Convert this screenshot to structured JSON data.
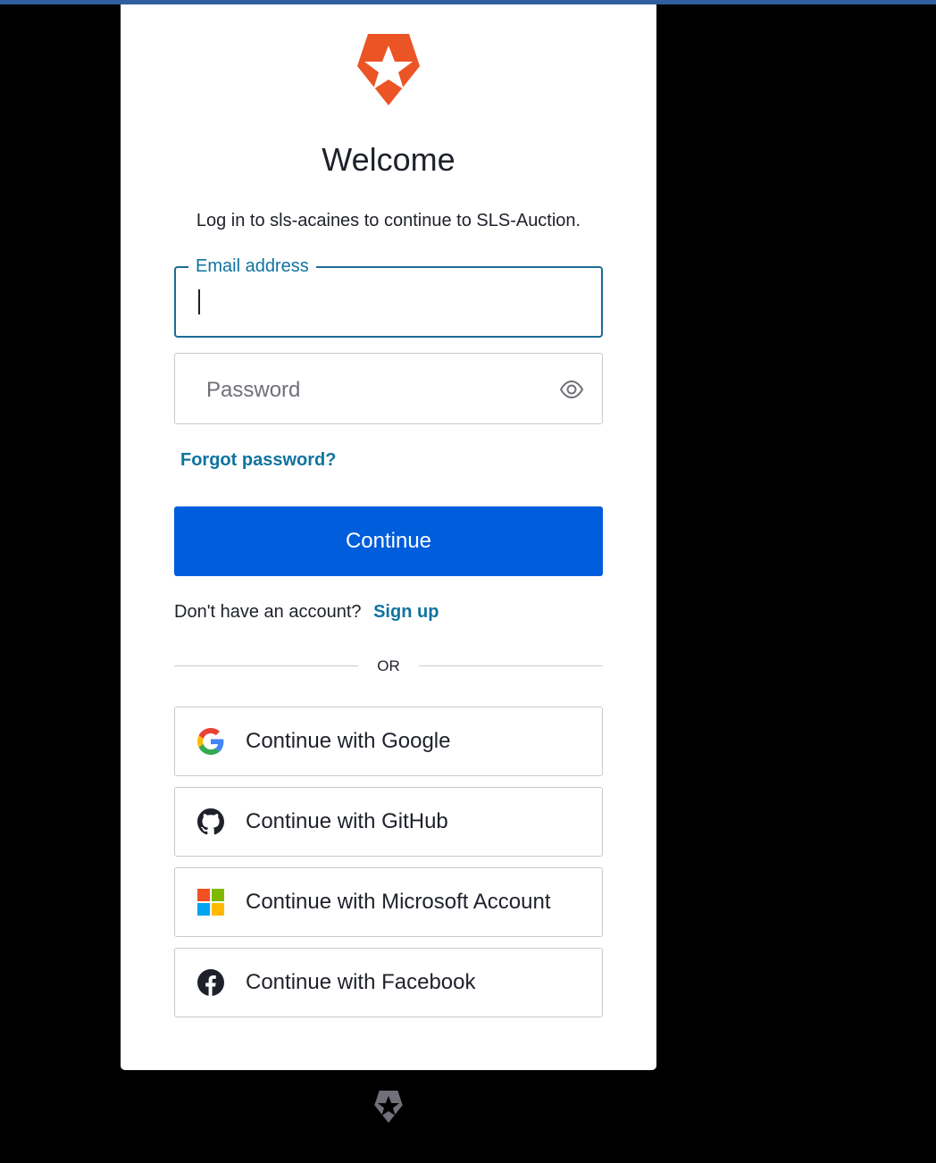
{
  "brand": {
    "logo_icon": "auth0-shield-star-icon",
    "accent_color": "#eb5424",
    "primary_color": "#005ddb",
    "link_color": "#0f73a0"
  },
  "header": {
    "title": "Welcome",
    "subtitle": "Log in to sls-acaines to continue to SLS-Auction."
  },
  "form": {
    "email": {
      "label": "Email address",
      "value": ""
    },
    "password": {
      "placeholder": "Password",
      "toggle_icon": "eye-icon"
    },
    "forgot_label": "Forgot password?",
    "continue_label": "Continue"
  },
  "signup": {
    "prompt": "Don't have an account?",
    "link_label": "Sign up"
  },
  "divider": {
    "label": "OR"
  },
  "social": [
    {
      "label": "Continue with Google",
      "icon": "google-icon"
    },
    {
      "label": "Continue with GitHub",
      "icon": "github-icon"
    },
    {
      "label": "Continue with Microsoft Account",
      "icon": "microsoft-icon"
    },
    {
      "label": "Continue with Facebook",
      "icon": "facebook-icon"
    }
  ],
  "footer": {
    "logo_icon": "auth0-footer-icon"
  }
}
